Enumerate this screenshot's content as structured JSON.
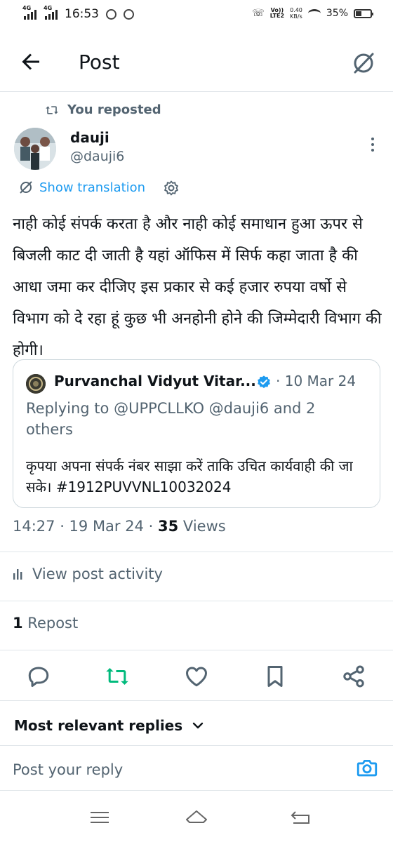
{
  "status_bar": {
    "network1": "4G",
    "network2": "4G",
    "time": "16:53",
    "volte": "Vo))",
    "lte": "LTE2",
    "speed_value": "0.40",
    "speed_unit": "KB/s",
    "battery": "35%"
  },
  "header": {
    "title": "Post"
  },
  "post": {
    "reposted_label": "You reposted",
    "author_name": "dauji",
    "author_handle": "@dauji6",
    "translate_label": "Show translation",
    "text": "नाही कोई संपर्क करता है और नाही कोई समाधान हुआ ऊपर से बिजली काट दी जाती है यहां ऑफिस में सिर्फ कहा जाता है की आधा जमा कर दीजिए इस प्रकार से कई हजार रुपया वर्षो से विभाग को दे रहा हूं कुछ भी अनहोनी होने की जिम्मेदारी विभाग की होगी।",
    "timestamp": "14:27 · 19 Mar 24 · ",
    "views_count": "35",
    "views_label": " Views"
  },
  "quote": {
    "name": "Purvanchal Vidyut Vitar...",
    "date": "· 10 Mar 24",
    "replying_to": "Replying to @UPPCLLKO @dauji6 and 2 others",
    "text": "कृपया अपना संपर्क नंबर साझा करें ताकि उचित कार्यवाही की जा सके। #1912PUVVNL10032024"
  },
  "activity": {
    "label": "View post activity"
  },
  "stats": {
    "repost_count": "1",
    "repost_label": " Repost"
  },
  "replies": {
    "sort_label": "Most relevant replies",
    "placeholder": "Post your reply"
  },
  "colors": {
    "accent": "#1d9bf0",
    "repost_green": "#00ba7c",
    "secondary_text": "#536471",
    "primary_text": "#0f1419"
  },
  "icons": {
    "back": "arrow-left-icon",
    "grok": "grok-icon",
    "repost": "repost-icon",
    "more": "more-vertical-icon",
    "translate": "translate-icon",
    "gear": "gear-icon",
    "verified": "verified-badge-icon",
    "activity": "bar-chart-icon",
    "reply": "reply-icon",
    "like": "heart-icon",
    "bookmark": "bookmark-icon",
    "share": "share-icon",
    "chevron": "chevron-down-icon",
    "camera": "camera-icon",
    "nav_menu": "menu-icon",
    "nav_home": "home-icon",
    "nav_back": "back-icon"
  }
}
